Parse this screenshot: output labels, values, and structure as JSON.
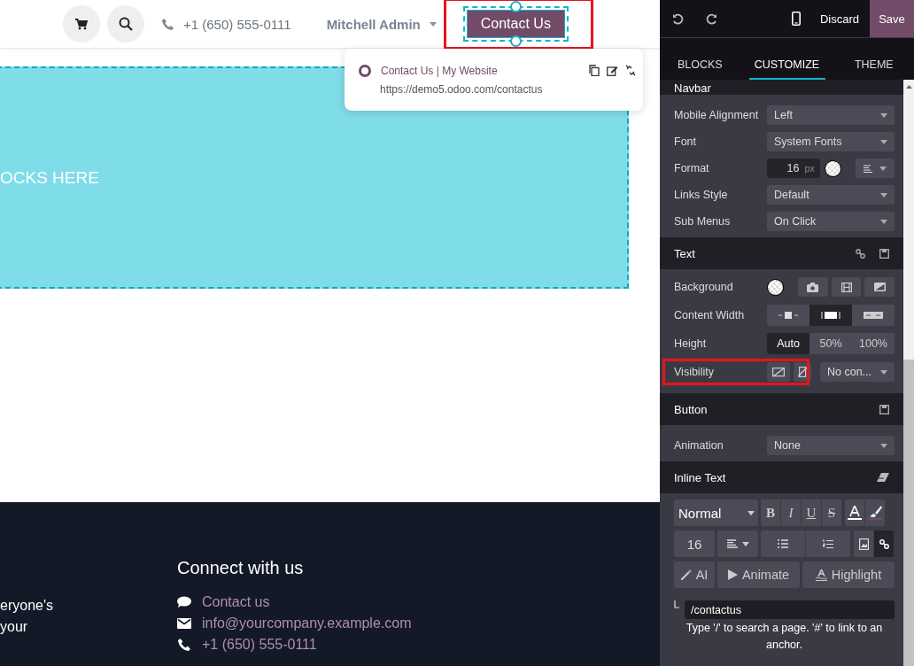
{
  "header": {
    "phone": "+1 (650) 555-0111",
    "user": "Mitchell Admin",
    "cta": {
      "label": "Contact Us",
      "annotated": true
    }
  },
  "link_popover": {
    "title": "Contact Us | My Website",
    "url": "https://demo5.odoo.com/contactus"
  },
  "drop_zone": {
    "text": "OCKS HERE"
  },
  "footer": {
    "left_lines": [
      "eryone's",
      "your"
    ],
    "heading": "Connect with us",
    "links": [
      {
        "kind": "chat",
        "text": "Contact us"
      },
      {
        "kind": "mail",
        "text": "info@yourcompany.example.com"
      },
      {
        "kind": "phone",
        "text": "+1 (650) 555-0111"
      }
    ]
  },
  "editor": {
    "discard": "Discard",
    "save": "Save",
    "tabs": [
      {
        "label": "BLOCKS",
        "selected": false
      },
      {
        "label": "CUSTOMIZE",
        "selected": true
      },
      {
        "label": "THEME",
        "selected": false
      }
    ],
    "sections": [
      {
        "title": "Navbar",
        "rows": [
          {
            "kind": "select",
            "label": "Mobile Alignment",
            "value": "Left"
          },
          {
            "kind": "select",
            "label": "Font",
            "value": "System Fonts"
          },
          {
            "kind": "format",
            "label": "Format",
            "value": "16",
            "unit": "px"
          },
          {
            "kind": "select",
            "label": "Links Style",
            "value": "Default"
          },
          {
            "kind": "select",
            "label": "Sub Menus",
            "value": "On Click"
          }
        ]
      },
      {
        "title": "Text",
        "rows": [
          {
            "kind": "background",
            "label": "Background"
          },
          {
            "kind": "width",
            "label": "Content Width",
            "options": [
              {
                "selected": false
              },
              {
                "selected": true
              },
              {
                "selected": false
              }
            ]
          },
          {
            "kind": "height",
            "label": "Height",
            "options": [
              {
                "label": "Auto",
                "selected": true
              },
              {
                "label": "50%",
                "selected": false
              },
              {
                "label": "100%",
                "selected": false
              }
            ]
          },
          {
            "kind": "visibility",
            "label": "Visibility",
            "value": "No con...",
            "annotated": true
          }
        ]
      },
      {
        "title": "Button",
        "rows": [
          {
            "kind": "select",
            "label": "Animation",
            "value": "None"
          }
        ]
      }
    ],
    "inline_text": {
      "title": "Inline Text",
      "style": "Normal",
      "marks": [
        "B",
        "I",
        "U",
        "S"
      ],
      "size": "16",
      "link_active": true,
      "ai": "AI",
      "animate": "Animate",
      "highlight": "Highlight",
      "link_value": "/contactus",
      "hint": "Type '/' to search a page. '#' to link to an anchor."
    }
  }
}
